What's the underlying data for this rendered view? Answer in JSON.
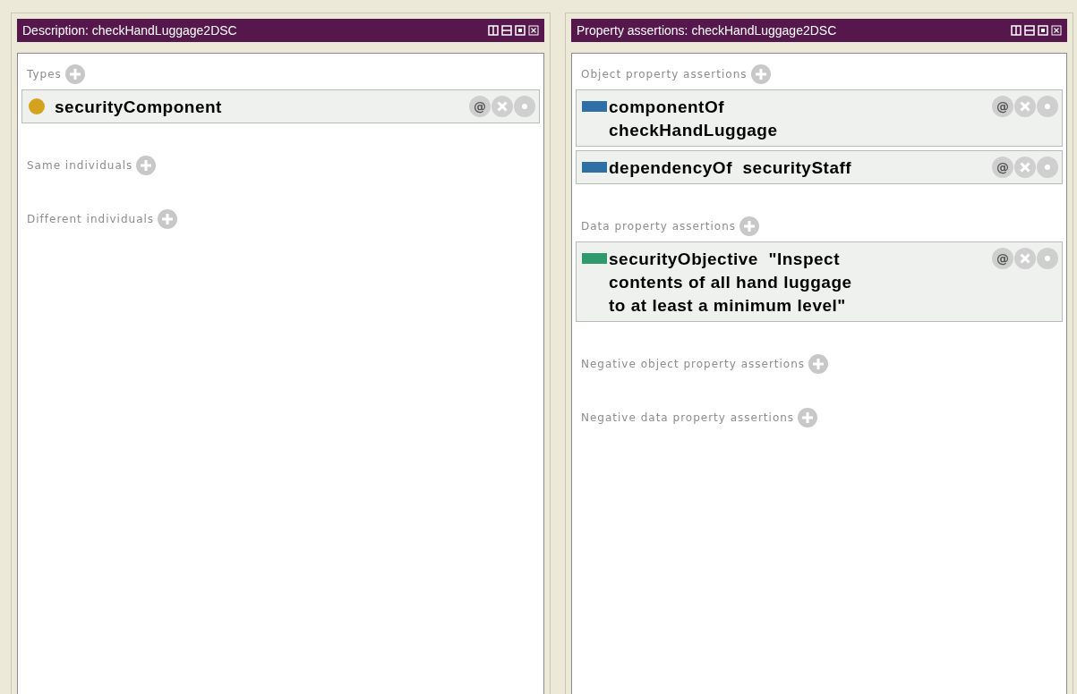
{
  "panels": [
    {
      "title": "Description: checkHandLuggage2DSC",
      "sections": [
        {
          "label": "Types",
          "items": [
            {
              "kind": "class",
              "lines": [
                "securityComponent"
              ],
              "annotate": "@"
            }
          ]
        },
        {
          "label": "Same individuals"
        },
        {
          "label": "Different individuals"
        }
      ]
    },
    {
      "title": "Property assertions: checkHandLuggage2DSC",
      "sections": [
        {
          "label": "Object property assertions",
          "items": [
            {
              "kind": "object",
              "lines": [
                "componentOf",
                "checkHandLuggage"
              ],
              "annotate": "@"
            },
            {
              "kind": "object",
              "lines": [
                "dependencyOf  securityStaff"
              ],
              "annotate": "@"
            }
          ]
        },
        {
          "label": "Data property assertions",
          "items": [
            {
              "kind": "data",
              "lines": [
                "securityObjective  \"Inspect",
                "contents of all hand luggage",
                "to at least a minimum level\""
              ],
              "annotate": "@"
            }
          ]
        },
        {
          "label": "Negative object property assertions"
        },
        {
          "label": "Negative data property assertions"
        }
      ]
    }
  ]
}
